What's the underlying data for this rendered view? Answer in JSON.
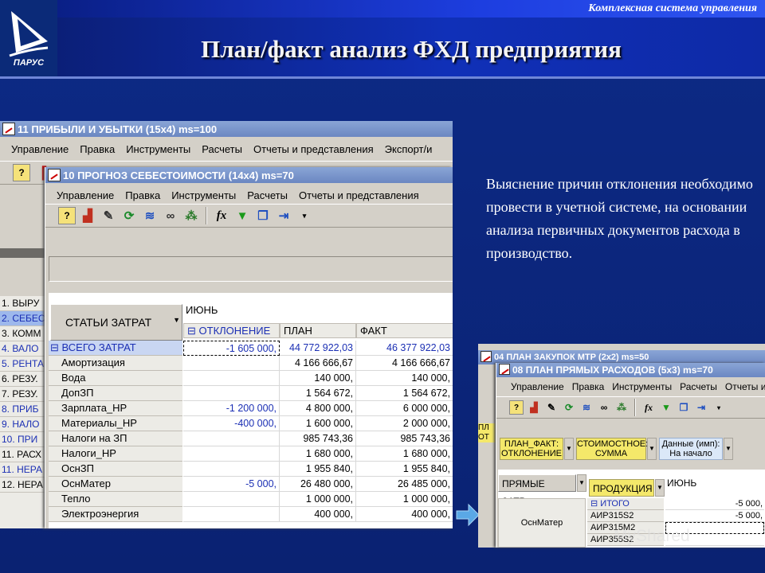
{
  "slide": {
    "tagline": "Комплексная система управления",
    "title": "План/факт анализ  ФХД предприятия",
    "logo_text": "ПАРУС",
    "body_text": "Выяснение причин отклонения необходимо провести в учетной системе, на основании анализа первичных документов расхода в производство."
  },
  "win1": {
    "title": "11 ПРИБЫЛИ И УБЫТКИ (15x4) ms=100",
    "menu": [
      "Управление",
      "Правка",
      "Инструменты",
      "Расчеты",
      "Отчеты и представления",
      "Экспорт/и"
    ],
    "left_items": [
      "1. ВЫРУ",
      "2. СЕБЕС",
      "3. КОММ",
      "4. ВАЛО",
      "5. РЕНТА",
      "6. РЕЗУ.",
      "7. РЕЗУ.",
      "8. ПРИБ",
      "9. НАЛО",
      "10. ПРИ",
      "11. РАСХ",
      "11. НЕРА",
      "12. НЕРА"
    ]
  },
  "win2": {
    "title": "10 ПРОГНОЗ СЕБЕСТОИМОСТИ (14x4) ms=70",
    "menu": [
      "Управление",
      "Правка",
      "Инструменты",
      "Расчеты",
      "Отчеты и представления"
    ],
    "row_header_button": "СТАТЬИ ЗАТРАТ",
    "month": "ИЮНЬ",
    "columns": [
      "ОТКЛОНЕНИЕ",
      "ПЛАН",
      "ФАКТ"
    ],
    "rows": [
      {
        "label": "ВСЕГО ЗАТРАТ",
        "dev": "-1 605 000,",
        "plan": "44 772 922,03",
        "fact": "46 377 922,03"
      },
      {
        "label": "Амортизация",
        "dev": "",
        "plan": "4 166 666,67",
        "fact": "4 166 666,67"
      },
      {
        "label": "Вода",
        "dev": "",
        "plan": "140 000,",
        "fact": "140 000,"
      },
      {
        "label": "ДопЗП",
        "dev": "",
        "plan": "1 564 672,",
        "fact": "1 564 672,"
      },
      {
        "label": "Зарплата_НР",
        "dev": "-1 200 000,",
        "plan": "4 800 000,",
        "fact": "6 000 000,"
      },
      {
        "label": "Материалы_НР",
        "dev": "-400 000,",
        "plan": "1 600 000,",
        "fact": "2 000 000,"
      },
      {
        "label": "Налоги на ЗП",
        "dev": "",
        "plan": "985 743,36",
        "fact": "985 743,36"
      },
      {
        "label": "Налоги_НР",
        "dev": "",
        "plan": "1 680 000,",
        "fact": "1 680 000,"
      },
      {
        "label": "ОснЗП",
        "dev": "",
        "plan": "1 955 840,",
        "fact": "1 955 840,"
      },
      {
        "label": "ОснМатер",
        "dev": "-5 000,",
        "plan": "26 480 000,",
        "fact": "26 485 000,"
      },
      {
        "label": "Тепло",
        "dev": "",
        "plan": "1 000 000,",
        "fact": "1 000 000,"
      },
      {
        "label": "Электроэнергия",
        "dev": "",
        "plan": "400 000,",
        "fact": "400 000,"
      }
    ]
  },
  "win3": {
    "title": "04 ПЛАН ЗАКУПОК МТР (2x2) ms=50",
    "side_labels": [
      "ПЛ",
      "ОТ"
    ]
  },
  "win4": {
    "title": "08 ПЛАН ПРЯМЫХ РАСХОДОВ (5x3) ms=70",
    "menu": [
      "Управление",
      "Правка",
      "Инструменты",
      "Расчеты",
      "Отчеты и"
    ],
    "chips": [
      {
        "line1": "ПЛАН_ФАКТ:",
        "line2": "ОТКЛОНЕНИЕ"
      },
      {
        "line1": "СТОИМОСТНОЕ:",
        "line2": "СУММА"
      },
      {
        "line1": "Данные (имп):",
        "line2": "На начало"
      }
    ],
    "col_direct": "ПРЯМЫЕ ЗАТР...",
    "col_product": "ПРОДУКЦИЯ",
    "month": "ИЮНЬ",
    "row_label": "ОснМатер",
    "items": [
      {
        "label": "ИТОГО",
        "value": "-5 000,"
      },
      {
        "label": "АИР315S2",
        "value": "-5 000,"
      },
      {
        "label": "АИР315M2",
        "value": ""
      },
      {
        "label": "АИР355S2",
        "value": ""
      }
    ]
  },
  "watermark": "MyShared"
}
